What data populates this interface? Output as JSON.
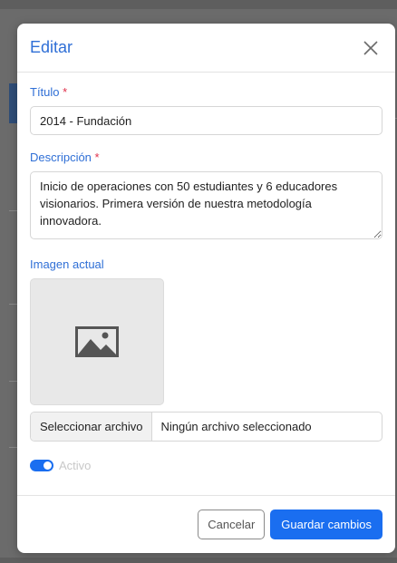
{
  "modal": {
    "title": "Editar",
    "close_icon": "close-icon"
  },
  "fields": {
    "title_label": "Título",
    "title_value": "2014 - Fundación",
    "description_label": "Descripción",
    "description_value": "Inicio de operaciones con 50 estudiantes y 6 educadores visionarios. Primera versión de nuestra metodología innovadora.",
    "required_mark": "*",
    "image_label": "Imagen actual",
    "image_icon": "image-placeholder-icon",
    "file_button_label": "Seleccionar archivo",
    "file_status": "Ningún archivo seleccionado",
    "active_label": "Activo",
    "active_on": true
  },
  "footer": {
    "cancel_label": "Cancelar",
    "save_label": "Guardar cambios"
  },
  "colors": {
    "accent": "#1a6ef0",
    "label_blue": "#2f6fd6",
    "required_red": "#e0314b"
  }
}
